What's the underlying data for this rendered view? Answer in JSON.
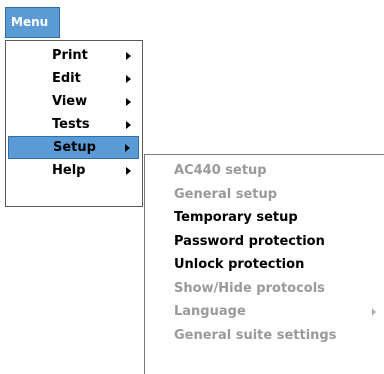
{
  "menu_button": {
    "label": "Menu"
  },
  "main_menu": {
    "items": [
      {
        "label": "Print",
        "has_submenu": true
      },
      {
        "label": "Edit",
        "has_submenu": true
      },
      {
        "label": "View",
        "has_submenu": true
      },
      {
        "label": "Tests",
        "has_submenu": true
      },
      {
        "label": "Setup",
        "has_submenu": true,
        "selected": true
      },
      {
        "label": "Help",
        "has_submenu": true
      }
    ]
  },
  "setup_submenu": {
    "items": [
      {
        "label": "AC440 setup",
        "enabled": false
      },
      {
        "label": "General setup",
        "enabled": false
      },
      {
        "label": "Temporary setup",
        "enabled": true
      },
      {
        "label": "Password protection",
        "enabled": true
      },
      {
        "label": "Unlock protection",
        "enabled": true
      },
      {
        "label": "Show/Hide protocols",
        "enabled": false
      },
      {
        "label": "Language",
        "enabled": false,
        "has_submenu": true
      },
      {
        "label": "General suite settings",
        "enabled": false
      }
    ]
  },
  "colors": {
    "highlight": "#5b9bd5",
    "highlight_border": "#2e6fb0",
    "disabled_text": "#9a9a9a",
    "text": "#000000"
  }
}
